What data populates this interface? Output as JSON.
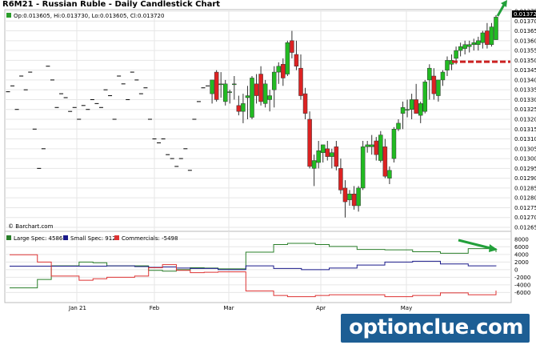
{
  "header": {
    "title": "R6M21 - Russian Ruble - Daily Candlestick Chart"
  },
  "price_legend": {
    "text": "Op:0.013605, Hi:0.013730, Lo:0.013605, Cl:0.013720",
    "color": "#2a9d2a"
  },
  "copyright": "© Barchart.com",
  "watermark": "optionclue.com",
  "colors": {
    "up_candle": "#22bb22",
    "down_candle": "#dd2222",
    "large_spec": "#2a7f2a",
    "small_spec": "#1a1a8a",
    "commercials": "#dd3333",
    "arrow": "#22a03a",
    "resistance_line": "#cc2222",
    "grid": "#e6e6e6",
    "last_price_box": "#000000"
  },
  "icons": [
    "up-arrow-icon",
    "down-right-arrow-icon"
  ],
  "chart_data": [
    {
      "type": "candlestick",
      "title": "R6M21 - Russian Ruble - Daily Candlestick Chart",
      "y_ticks": [
        "0.012650",
        "0.012700",
        "0.012750",
        "0.012800",
        "0.012850",
        "0.012900",
        "0.012950",
        "0.013000",
        "0.013050",
        "0.013100",
        "0.013150",
        "0.013200",
        "0.013250",
        "0.013300",
        "0.013350",
        "0.013400",
        "0.013450",
        "0.013500",
        "0.013550",
        "0.013600",
        "0.013650",
        "0.013700",
        "0.013750"
      ],
      "ylim": [
        0.01265,
        0.01375
      ],
      "last_price": "0.013720",
      "resistance_level": 0.013493,
      "x_labels": [
        "Jan 21",
        "Feb",
        "Mar",
        "Apr",
        "May"
      ],
      "candles": [
        {
          "o": 0.01334,
          "h": 0.01334,
          "l": 0.01334,
          "c": 0.01334
        },
        {
          "o": 0.01337,
          "h": 0.01337,
          "l": 0.01337,
          "c": 0.01337
        },
        {
          "o": 0.01325,
          "h": 0.01325,
          "l": 0.01325,
          "c": 0.01325
        },
        {
          "o": 0.01342,
          "h": 0.01342,
          "l": 0.01342,
          "c": 0.01342
        },
        {
          "o": 0.01335,
          "h": 0.01335,
          "l": 0.01335,
          "c": 0.01335
        },
        {
          "o": 0.01344,
          "h": 0.01344,
          "l": 0.01344,
          "c": 0.01344
        },
        {
          "o": 0.01315,
          "h": 0.01315,
          "l": 0.01315,
          "c": 0.01315
        },
        {
          "o": 0.01295,
          "h": 0.01295,
          "l": 0.01295,
          "c": 0.01295
        },
        {
          "o": 0.01305,
          "h": 0.01305,
          "l": 0.01305,
          "c": 0.01305
        },
        {
          "o": 0.01347,
          "h": 0.01347,
          "l": 0.01347,
          "c": 0.01347
        },
        {
          "o": 0.0134,
          "h": 0.0134,
          "l": 0.0134,
          "c": 0.0134
        },
        {
          "o": 0.01326,
          "h": 0.01326,
          "l": 0.01326,
          "c": 0.01326
        },
        {
          "o": 0.01333,
          "h": 0.01333,
          "l": 0.01333,
          "c": 0.01333
        },
        {
          "o": 0.01331,
          "h": 0.01331,
          "l": 0.01331,
          "c": 0.01331
        },
        {
          "o": 0.01324,
          "h": 0.01324,
          "l": 0.01324,
          "c": 0.01324
        },
        {
          "o": 0.01326,
          "h": 0.01326,
          "l": 0.01326,
          "c": 0.01326
        },
        {
          "o": 0.0132,
          "h": 0.0132,
          "l": 0.0132,
          "c": 0.0132
        },
        {
          "o": 0.01327,
          "h": 0.01327,
          "l": 0.01327,
          "c": 0.01327
        },
        {
          "o": 0.01325,
          "h": 0.01325,
          "l": 0.01325,
          "c": 0.01325
        },
        {
          "o": 0.0133,
          "h": 0.0133,
          "l": 0.0133,
          "c": 0.0133
        },
        {
          "o": 0.01328,
          "h": 0.01328,
          "l": 0.01328,
          "c": 0.01328
        },
        {
          "o": 0.01326,
          "h": 0.01326,
          "l": 0.01326,
          "c": 0.01326
        },
        {
          "o": 0.01335,
          "h": 0.01335,
          "l": 0.01335,
          "c": 0.01335
        },
        {
          "o": 0.01332,
          "h": 0.01332,
          "l": 0.01332,
          "c": 0.01332
        },
        {
          "o": 0.0132,
          "h": 0.0132,
          "l": 0.0132,
          "c": 0.0132
        },
        {
          "o": 0.01342,
          "h": 0.01342,
          "l": 0.01342,
          "c": 0.01342
        },
        {
          "o": 0.01338,
          "h": 0.01338,
          "l": 0.01338,
          "c": 0.01338
        },
        {
          "o": 0.0133,
          "h": 0.0133,
          "l": 0.0133,
          "c": 0.0133
        },
        {
          "o": 0.01344,
          "h": 0.01344,
          "l": 0.01344,
          "c": 0.01344
        },
        {
          "o": 0.0134,
          "h": 0.0134,
          "l": 0.0134,
          "c": 0.0134
        },
        {
          "o": 0.01333,
          "h": 0.01333,
          "l": 0.01333,
          "c": 0.01333
        },
        {
          "o": 0.01336,
          "h": 0.01336,
          "l": 0.01336,
          "c": 0.01336
        },
        {
          "o": 0.0132,
          "h": 0.0132,
          "l": 0.0132,
          "c": 0.0132
        },
        {
          "o": 0.0131,
          "h": 0.0131,
          "l": 0.0131,
          "c": 0.0131
        },
        {
          "o": 0.01308,
          "h": 0.01308,
          "l": 0.01308,
          "c": 0.01308
        },
        {
          "o": 0.0131,
          "h": 0.0131,
          "l": 0.0131,
          "c": 0.0131
        },
        {
          "o": 0.01302,
          "h": 0.01302,
          "l": 0.01302,
          "c": 0.01302
        },
        {
          "o": 0.013,
          "h": 0.013,
          "l": 0.013,
          "c": 0.013
        },
        {
          "o": 0.01296,
          "h": 0.01296,
          "l": 0.01296,
          "c": 0.01296
        },
        {
          "o": 0.013,
          "h": 0.013,
          "l": 0.013,
          "c": 0.013
        },
        {
          "o": 0.01305,
          "h": 0.01305,
          "l": 0.01305,
          "c": 0.01305
        },
        {
          "o": 0.01294,
          "h": 0.01294,
          "l": 0.01294,
          "c": 0.01294
        },
        {
          "o": 0.0132,
          "h": 0.0132,
          "l": 0.0132,
          "c": 0.0132
        },
        {
          "o": 0.01329,
          "h": 0.01329,
          "l": 0.01329,
          "c": 0.01329
        },
        {
          "o": 0.01336,
          "h": 0.01336,
          "l": 0.01336,
          "c": 0.01336
        },
        {
          "o": 0.01337,
          "h": 0.01337,
          "l": 0.01337,
          "c": 0.01337
        },
        {
          "o": 0.01333,
          "h": 0.0134,
          "l": 0.01328,
          "c": 0.0134
        },
        {
          "o": 0.01344,
          "h": 0.01345,
          "l": 0.01329,
          "c": 0.0133
        },
        {
          "o": 0.01338,
          "h": 0.01344,
          "l": 0.01331,
          "c": 0.01338
        },
        {
          "o": 0.01329,
          "h": 0.0134,
          "l": 0.01327,
          "c": 0.01338
        },
        {
          "o": 0.01334,
          "h": 0.01335,
          "l": 0.01328,
          "c": 0.01334
        },
        {
          "o": 0.01338,
          "h": 0.01342,
          "l": 0.0133,
          "c": 0.01338
        },
        {
          "o": 0.01327,
          "h": 0.01332,
          "l": 0.01322,
          "c": 0.01324
        },
        {
          "o": 0.01324,
          "h": 0.01333,
          "l": 0.01318,
          "c": 0.01328
        },
        {
          "o": 0.01331,
          "h": 0.01337,
          "l": 0.0132,
          "c": 0.01332
        },
        {
          "o": 0.01321,
          "h": 0.01342,
          "l": 0.0132,
          "c": 0.01341
        },
        {
          "o": 0.01338,
          "h": 0.01343,
          "l": 0.01328,
          "c": 0.01332
        },
        {
          "o": 0.01343,
          "h": 0.01347,
          "l": 0.01327,
          "c": 0.01329
        },
        {
          "o": 0.01328,
          "h": 0.0134,
          "l": 0.01326,
          "c": 0.01338
        },
        {
          "o": 0.0133,
          "h": 0.01335,
          "l": 0.01324,
          "c": 0.01332
        },
        {
          "o": 0.01335,
          "h": 0.01347,
          "l": 0.01326,
          "c": 0.01344
        },
        {
          "o": 0.01344,
          "h": 0.01349,
          "l": 0.01338,
          "c": 0.01347
        },
        {
          "o": 0.01348,
          "h": 0.01351,
          "l": 0.01337,
          "c": 0.01341
        },
        {
          "o": 0.01343,
          "h": 0.0136,
          "l": 0.01342,
          "c": 0.01359
        },
        {
          "o": 0.0136,
          "h": 0.01365,
          "l": 0.01351,
          "c": 0.01354
        },
        {
          "o": 0.01353,
          "h": 0.0136,
          "l": 0.01345,
          "c": 0.01347
        },
        {
          "o": 0.01346,
          "h": 0.01353,
          "l": 0.0133,
          "c": 0.01332
        },
        {
          "o": 0.01333,
          "h": 0.01336,
          "l": 0.0132,
          "c": 0.01323
        },
        {
          "o": 0.0132,
          "h": 0.01324,
          "l": 0.01295,
          "c": 0.01296
        },
        {
          "o": 0.01295,
          "h": 0.01302,
          "l": 0.01286,
          "c": 0.01299
        },
        {
          "o": 0.01298,
          "h": 0.01309,
          "l": 0.01295,
          "c": 0.01304
        },
        {
          "o": 0.01303,
          "h": 0.01307,
          "l": 0.01298,
          "c": 0.01307
        },
        {
          "o": 0.01305,
          "h": 0.01309,
          "l": 0.01299,
          "c": 0.01301
        },
        {
          "o": 0.01301,
          "h": 0.01305,
          "l": 0.01295,
          "c": 0.01303
        },
        {
          "o": 0.01306,
          "h": 0.01309,
          "l": 0.01294,
          "c": 0.01296
        },
        {
          "o": 0.01295,
          "h": 0.013,
          "l": 0.01282,
          "c": 0.01284
        },
        {
          "o": 0.01285,
          "h": 0.01289,
          "l": 0.0127,
          "c": 0.01278
        },
        {
          "o": 0.01279,
          "h": 0.01284,
          "l": 0.01276,
          "c": 0.01282
        },
        {
          "o": 0.01282,
          "h": 0.01286,
          "l": 0.01274,
          "c": 0.01276
        },
        {
          "o": 0.01276,
          "h": 0.01286,
          "l": 0.01273,
          "c": 0.01285
        },
        {
          "o": 0.01285,
          "h": 0.01309,
          "l": 0.01284,
          "c": 0.01306
        },
        {
          "o": 0.01306,
          "h": 0.01309,
          "l": 0.01303,
          "c": 0.01307
        },
        {
          "o": 0.01306,
          "h": 0.01312,
          "l": 0.01302,
          "c": 0.01307
        },
        {
          "o": 0.01309,
          "h": 0.01311,
          "l": 0.01299,
          "c": 0.01302
        },
        {
          "o": 0.01299,
          "h": 0.01314,
          "l": 0.01298,
          "c": 0.01312
        },
        {
          "o": 0.01306,
          "h": 0.0131,
          "l": 0.0129,
          "c": 0.01291
        },
        {
          "o": 0.0129,
          "h": 0.01296,
          "l": 0.01287,
          "c": 0.01294
        },
        {
          "o": 0.013,
          "h": 0.01316,
          "l": 0.01298,
          "c": 0.01315
        },
        {
          "o": 0.01315,
          "h": 0.0132,
          "l": 0.01314,
          "c": 0.01318
        },
        {
          "o": 0.01323,
          "h": 0.01329,
          "l": 0.01315,
          "c": 0.01326
        },
        {
          "o": 0.01325,
          "h": 0.0133,
          "l": 0.01321,
          "c": 0.01325
        },
        {
          "o": 0.01325,
          "h": 0.01333,
          "l": 0.0132,
          "c": 0.0133
        },
        {
          "o": 0.0133,
          "h": 0.01338,
          "l": 0.01323,
          "c": 0.01323
        },
        {
          "o": 0.01322,
          "h": 0.01329,
          "l": 0.01318,
          "c": 0.01328
        },
        {
          "o": 0.01324,
          "h": 0.0134,
          "l": 0.01323,
          "c": 0.01339
        },
        {
          "o": 0.0134,
          "h": 0.01348,
          "l": 0.0133,
          "c": 0.01346
        },
        {
          "o": 0.01342,
          "h": 0.01346,
          "l": 0.0133,
          "c": 0.01333
        },
        {
          "o": 0.01332,
          "h": 0.0134,
          "l": 0.01329,
          "c": 0.0134
        },
        {
          "o": 0.0134,
          "h": 0.01345,
          "l": 0.01337,
          "c": 0.01344
        },
        {
          "o": 0.01345,
          "h": 0.01352,
          "l": 0.01342,
          "c": 0.0135
        },
        {
          "o": 0.01348,
          "h": 0.01353,
          "l": 0.01345,
          "c": 0.0135
        },
        {
          "o": 0.01351,
          "h": 0.01357,
          "l": 0.01348,
          "c": 0.01355
        },
        {
          "o": 0.01355,
          "h": 0.01359,
          "l": 0.01352,
          "c": 0.01357
        },
        {
          "o": 0.01356,
          "h": 0.0136,
          "l": 0.01353,
          "c": 0.01358
        },
        {
          "o": 0.01357,
          "h": 0.0136,
          "l": 0.01354,
          "c": 0.01358
        },
        {
          "o": 0.01358,
          "h": 0.01361,
          "l": 0.01355,
          "c": 0.01359
        },
        {
          "o": 0.01358,
          "h": 0.01362,
          "l": 0.01355,
          "c": 0.0136
        },
        {
          "o": 0.01359,
          "h": 0.01365,
          "l": 0.01356,
          "c": 0.01364
        },
        {
          "o": 0.01365,
          "h": 0.01369,
          "l": 0.01356,
          "c": 0.01358
        },
        {
          "o": 0.01358,
          "h": 0.01369,
          "l": 0.01357,
          "c": 0.01367
        },
        {
          "o": 0.013605,
          "h": 0.01373,
          "l": 0.013605,
          "c": 0.01372
        }
      ]
    },
    {
      "type": "line",
      "title": "",
      "y_ticks": [
        "8000",
        "6000",
        "4000",
        "2000",
        "0",
        "-2000",
        "-4000",
        "-6000"
      ],
      "ylim": [
        -7400,
        8800
      ],
      "series": [
        {
          "name": "Large Spec: 4586",
          "values": [
            -4800,
            -4800,
            -2600,
            1000,
            1000,
            2000,
            1800,
            1000,
            1000,
            1000,
            -200,
            -400,
            0,
            500,
            400,
            200,
            200,
            4600,
            4600,
            6600,
            6900,
            6900,
            6600,
            6100,
            6100,
            5300,
            5300,
            5200,
            5200,
            4700,
            4700,
            4300,
            4300,
            5500,
            5500,
            4600
          ]
        },
        {
          "name": "Small Spec: 912",
          "values": [
            900,
            900,
            900,
            900,
            900,
            900,
            900,
            1000,
            1000,
            800,
            600,
            700,
            400,
            300,
            300,
            0,
            0,
            1000,
            1000,
            300,
            300,
            0,
            0,
            400,
            400,
            1200,
            1200,
            2000,
            2000,
            2200,
            2200,
            1500,
            1500,
            1000,
            1000,
            900
          ]
        },
        {
          "name": "Commercials: -5498",
          "values": [
            3900,
            3900,
            2000,
            -1700,
            -1700,
            -2800,
            -2400,
            -2000,
            -2000,
            -1700,
            500,
            1300,
            -200,
            -800,
            -700,
            -600,
            -600,
            -5600,
            -5600,
            -6800,
            -7100,
            -7100,
            -6800,
            -6600,
            -6600,
            -6600,
            -6600,
            -7100,
            -7100,
            -6800,
            -6800,
            -6100,
            -6100,
            -6600,
            -6600,
            -5500
          ]
        }
      ]
    }
  ]
}
